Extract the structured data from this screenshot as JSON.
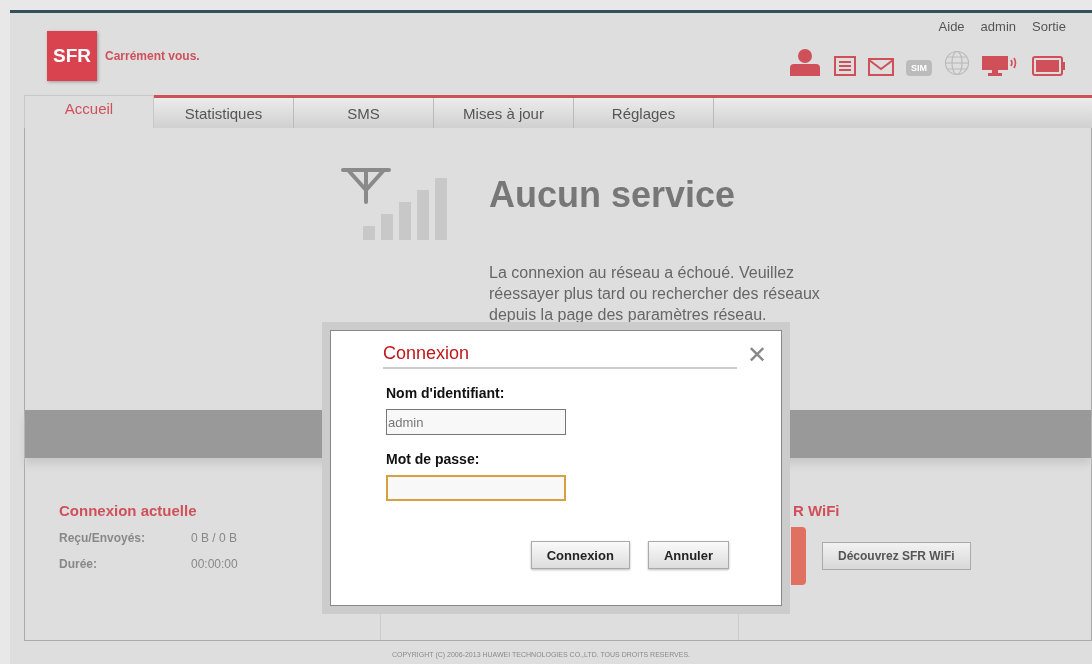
{
  "header": {
    "logo": "SFR",
    "slogan": "Carrément vous.",
    "links": [
      "Aide",
      "admin",
      "Sortie"
    ],
    "status_icons": [
      {
        "kind": "person",
        "active": true
      },
      {
        "kind": "list",
        "active": true
      },
      {
        "kind": "mail",
        "active": true
      },
      {
        "kind": "sim",
        "active": false,
        "label": "SIM"
      },
      {
        "kind": "globe",
        "active": false
      },
      {
        "kind": "monitor",
        "active": true
      },
      {
        "kind": "battery",
        "active": true
      }
    ]
  },
  "tabs": [
    {
      "label": "Accueil",
      "selected": true
    },
    {
      "label": "Statistiques",
      "selected": false
    },
    {
      "label": "SMS",
      "selected": false
    },
    {
      "label": "Mises à jour",
      "selected": false
    },
    {
      "label": "Réglages",
      "selected": false
    }
  ],
  "status": {
    "title": "Aucun service",
    "message": "La connexion au réseau a échoué. Veuillez réessayer plus tard ou rechercher des réseaux depuis la page des paramètres réseau."
  },
  "current_connection": {
    "title": "Connexion actuelle",
    "rows": [
      {
        "label": "Reçu/Envoyés:",
        "value": "0 B /  0 B"
      },
      {
        "label": "Durée:",
        "value": "00:00:00"
      }
    ]
  },
  "wifi": {
    "title": "R WiFi",
    "button": "Découvrez SFR WiFi"
  },
  "footer": "COPYRIGHT (C) 2006-2013 HUAWEI TECHNOLOGIES CO.,LTD. TOUS DROITS RESERVES.",
  "dialog": {
    "title": "Connexion",
    "close": "✕",
    "fields": [
      {
        "label": "Nom d'identifiant:",
        "value": "admin",
        "focused": false
      },
      {
        "label": "Mot de passe:",
        "focused": true
      }
    ],
    "buttons": [
      "Connexion",
      "Annuler"
    ]
  }
}
